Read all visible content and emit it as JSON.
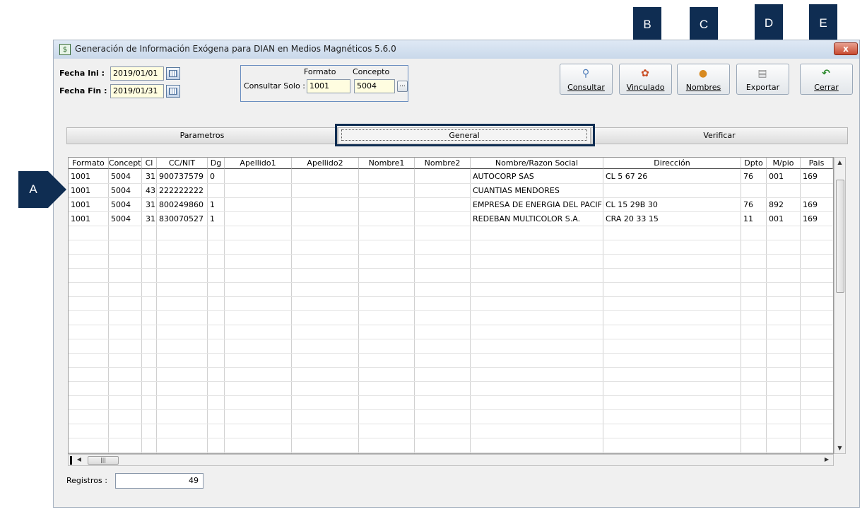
{
  "window": {
    "title": "Generación de Información Exógena para DIAN en Medios Magnéticos 5.6.0",
    "close_label": "x",
    "title_icon": "$"
  },
  "filters": {
    "fecha_ini_label": "Fecha Ini :",
    "fecha_ini_value": "2019/01/01",
    "fecha_fin_label": "Fecha Fin :",
    "fecha_fin_value": "2019/01/31",
    "consultar_solo_label": "Consultar Solo :",
    "formato_header": "Formato",
    "concepto_header": "Concepto",
    "formato_value": "1001",
    "concepto_value": "5004",
    "lookup_label": "..."
  },
  "toolbar": {
    "consultar": "Consultar",
    "vinculado": "Vinculado",
    "nombres": "Nombres",
    "exportar": "Exportar",
    "cerrar": "Cerrar"
  },
  "tabs": [
    "Parametros",
    "General",
    "Verificar"
  ],
  "grid": {
    "columns": [
      "Formato",
      "Concepto",
      "Cl",
      "CC/NIT",
      "Dg",
      "Apellido1",
      "Apellido2",
      "Nombre1",
      "Nombre2",
      "Nombre/Razon Social",
      "Dirección",
      "Dpto",
      "M/pio",
      "Pais"
    ],
    "rows": [
      [
        "1001",
        "5004",
        "31",
        "900737579",
        "0",
        "",
        "",
        "",
        "",
        "AUTOCORP SAS",
        "CL  5  67  26",
        "76",
        "001",
        "169"
      ],
      [
        "1001",
        "5004",
        "43",
        "222222222",
        "",
        "",
        "",
        "",
        "",
        "CUANTIAS MENDORES",
        "",
        "",
        "",
        ""
      ],
      [
        "1001",
        "5004",
        "31",
        "800249860",
        "1",
        "",
        "",
        "",
        "",
        "EMPRESA DE ENERGIA DEL PACIF",
        "CL 15  29B 30",
        "76",
        "892",
        "169"
      ],
      [
        "1001",
        "5004",
        "31",
        "830070527",
        "1",
        "",
        "",
        "",
        "",
        "REDEBAN MULTICOLOR S.A.",
        "CRA 20  33 15",
        "11",
        "001",
        "169"
      ]
    ]
  },
  "footer": {
    "registros_label": "Registros :",
    "registros_value": "49"
  },
  "callouts": {
    "a": "A",
    "b": "B",
    "c": "C",
    "d": "D",
    "e": "E",
    "color": "#0f2d52"
  },
  "icons": {
    "consultar": "magnifier-icon",
    "vinculado": "link-people-icon",
    "nombres": "people-icon",
    "exportar": "export-printer-icon",
    "cerrar": "undo-arrow-icon",
    "calendar": "calendar-icon"
  }
}
